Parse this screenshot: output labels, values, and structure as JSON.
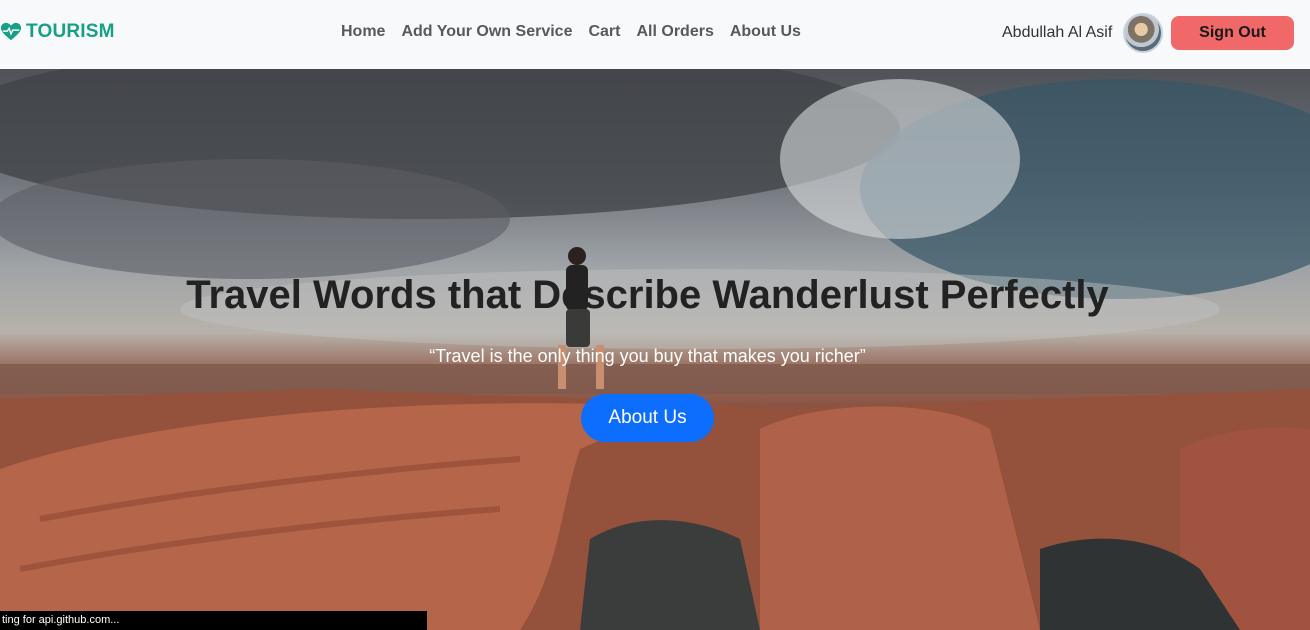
{
  "brand": {
    "name": "TOURISM",
    "icon": "heart-pulse-icon",
    "color": "#16a085"
  },
  "nav": {
    "links": [
      {
        "label": "Home"
      },
      {
        "label": "Add Your Own Service"
      },
      {
        "label": "Cart"
      },
      {
        "label": "All Orders"
      },
      {
        "label": "About Us"
      }
    ]
  },
  "user": {
    "name": "Abdullah Al Asif",
    "signout_label": "Sign Out",
    "signout_color": "#f06868"
  },
  "hero": {
    "title": "Travel Words that Describe Wanderlust Perfectly",
    "quote": "“Travel is the only thing you buy that makes you richer”",
    "cta_label": "About Us",
    "cta_color": "#0d6efd"
  },
  "status_bar": {
    "text": "ting for api.github.com..."
  }
}
